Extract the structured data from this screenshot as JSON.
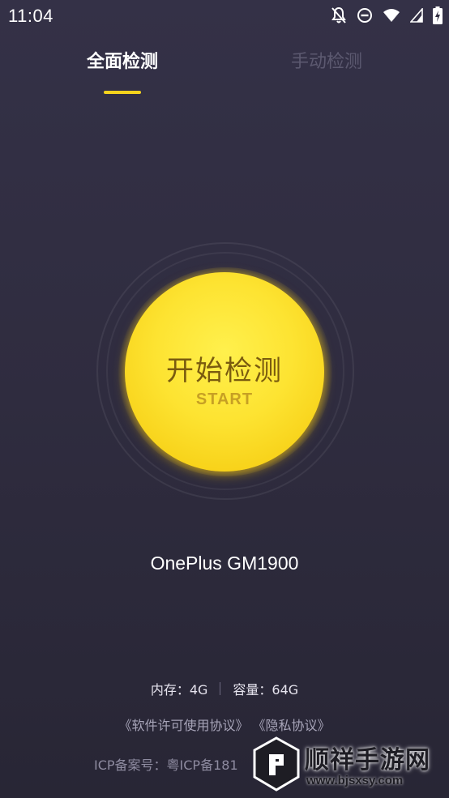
{
  "status_bar": {
    "time": "11:04",
    "icons": [
      "bell-off-icon",
      "do-not-disturb-icon",
      "wifi-icon",
      "signal-icon",
      "battery-charging-icon"
    ]
  },
  "tabs": [
    {
      "label": "全面检测",
      "active": true
    },
    {
      "label": "手动检测",
      "active": false
    }
  ],
  "start_button": {
    "title": "开始检测",
    "subtitle": "START"
  },
  "device": {
    "name": "OnePlus GM1900"
  },
  "specs": {
    "memory": "内存：4G",
    "storage": "容量：64G"
  },
  "agreements": {
    "license": "《软件许可使用协议》",
    "privacy": "《隐私协议》"
  },
  "icp": {
    "text": "ICP备案号：粤ICP备181"
  },
  "watermark": {
    "title": "顺祥手游网",
    "url": "www.bjsxsy.com"
  },
  "colors": {
    "accent": "#f5d31d",
    "background": "#302d40",
    "button_yellow": "#fde331"
  }
}
